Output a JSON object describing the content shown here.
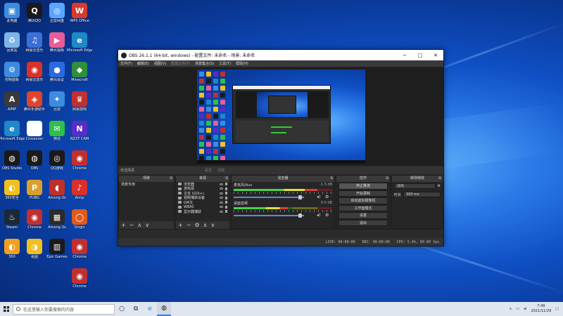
{
  "desktop": {
    "icons": [
      {
        "label": "此电脑",
        "color": "#3d8be0",
        "glyph": "▣"
      },
      {
        "label": "腾讯QQ",
        "color": "#1a1a1a",
        "glyph": "Q"
      },
      {
        "label": "迅雷网盘",
        "color": "#58a6ff",
        "glyph": "◎"
      },
      {
        "label": "WPS Office",
        "color": "#d83a2b",
        "glyph": "W"
      },
      {
        "label": "回收站",
        "color": "#7fb4e8",
        "glyph": "♻"
      },
      {
        "label": "网易云音乐",
        "color": "#3a6fd8",
        "glyph": "♫"
      },
      {
        "label": "腾讯视频",
        "color": "#e85c9b",
        "glyph": "▶"
      },
      {
        "label": "Microsoft Edge",
        "color": "#1e88c8",
        "glyph": "e"
      },
      {
        "label": "控制面板",
        "color": "#3d8be0",
        "glyph": "⚙"
      },
      {
        "label": "网易云音乐",
        "color": "#d8312b",
        "glyph": "◉"
      },
      {
        "label": "腾讯会议",
        "color": "#2a6ae0",
        "glyph": "●"
      },
      {
        "label": "Minecraft",
        "color": "#2f8f3a",
        "glyph": "◆"
      },
      {
        "label": "网易游戏",
        "color": "#c03030",
        "glyph": "♛"
      },
      {
        "label": "AIMP",
        "color": "#3a3a3a",
        "glyph": "A"
      },
      {
        "label": "腾讯手游助手",
        "color": "#e0452b",
        "glyph": "◈"
      },
      {
        "label": "迅雷",
        "color": "#3c8ce0",
        "glyph": "✦"
      },
      {
        "label": "Microsoft Edge",
        "color": "#1e88c8",
        "glyph": "e"
      },
      {
        "label": "Crossover",
        "color": "#ffffff",
        "glyph": "▤"
      },
      {
        "label": "微信",
        "color": "#2fbf4a",
        "glyph": "✉"
      },
      {
        "label": "NZXT CAM",
        "color": "#5a2bc8",
        "glyph": "N"
      },
      {
        "label": "Chrome",
        "color": "#c03030",
        "glyph": "◉"
      },
      {
        "label": "OBS Studio",
        "color": "#1a1a1a",
        "glyph": "◍"
      },
      {
        "label": "OBS",
        "color": "#1a1a1a",
        "glyph": "◍"
      },
      {
        "label": "QQ游戏",
        "color": "#1a1a1a",
        "glyph": "◎"
      },
      {
        "label": "Aimp",
        "color": "#d8312b",
        "glyph": "♪"
      },
      {
        "label": "360安全",
        "color": "#f0c020",
        "glyph": "◐"
      },
      {
        "label": "PUBG",
        "color": "#d8a030",
        "glyph": "P"
      },
      {
        "label": "Among Us",
        "color": "#c0302b",
        "glyph": "◖"
      },
      {
        "label": "Origin",
        "color": "#e05a1b",
        "glyph": "◯"
      },
      {
        "label": "Steam",
        "color": "#1b2838",
        "glyph": "♨"
      },
      {
        "label": "Chrome",
        "color": "#c03030",
        "glyph": "◉"
      },
      {
        "label": "Among Us",
        "color": "#2b2b2b",
        "glyph": "▦"
      },
      {
        "label": "Chrome",
        "color": "#c03030",
        "glyph": "◉"
      },
      {
        "label": "360",
        "color": "#f0a020",
        "glyph": "◐"
      },
      {
        "label": "看图",
        "color": "#f0c020",
        "glyph": "◑"
      },
      {
        "label": "Epic Games",
        "color": "#1a1a1a",
        "glyph": "▥"
      },
      {
        "label": "Chrome",
        "color": "#c03030",
        "glyph": "◉"
      }
    ]
  },
  "obs": {
    "title": "OBS 26.1.1 (64-bit, windows) - 配置文件: 未命名 - 场景: 未命名",
    "menu": [
      "文件(F)",
      "编辑(E)",
      "视图(V)",
      "配置文件(P)",
      "场景集合(S)",
      "工具(T)",
      "帮助(H)"
    ],
    "window_controls": {
      "minimize": "─",
      "maximize": "□",
      "close": "✕"
    },
    "status_row": {
      "label": "未选择源",
      "props": "属性",
      "filters": "滤镜"
    },
    "scenes": {
      "header": "场景",
      "items": [
        "场景专用"
      ]
    },
    "sources": {
      "header": "来源",
      "items": [
        "浏览器",
        "游戏源",
        "文本 (GDI+)",
        "视频捕获设备",
        "GM文",
        "WBAC",
        "显示器捕获"
      ]
    },
    "mixer": {
      "header": "混音器",
      "channels": [
        {
          "name": "麦克风/Aux",
          "db": "-1.3 dB",
          "level": 0.85
        },
        {
          "name": "桌面音频",
          "db": "0.0 dB",
          "level": 0.55
        }
      ]
    },
    "controls": {
      "header": "控件",
      "buttons": [
        "停止推流",
        "开始录制",
        "启动虚拟摄像机",
        "工作室模式",
        "设置",
        "退出"
      ]
    },
    "transitions": {
      "header": "转场特效",
      "type": "淡出",
      "duration_label": "时长",
      "duration": "300 ms"
    },
    "footer": {
      "add": "+",
      "remove": "−",
      "up": "∧",
      "down": "∨",
      "gear": "⚙"
    },
    "bottombar": {
      "live": "LIVE: 00:00:00",
      "rec": "REC: 00:00:00",
      "cpu": "CPU: 5.4%, 60.00 fps"
    }
  },
  "taskbar": {
    "search_placeholder": "在这里输入你要搜索的内容",
    "time": "7:49",
    "date": "2021/11/29"
  }
}
